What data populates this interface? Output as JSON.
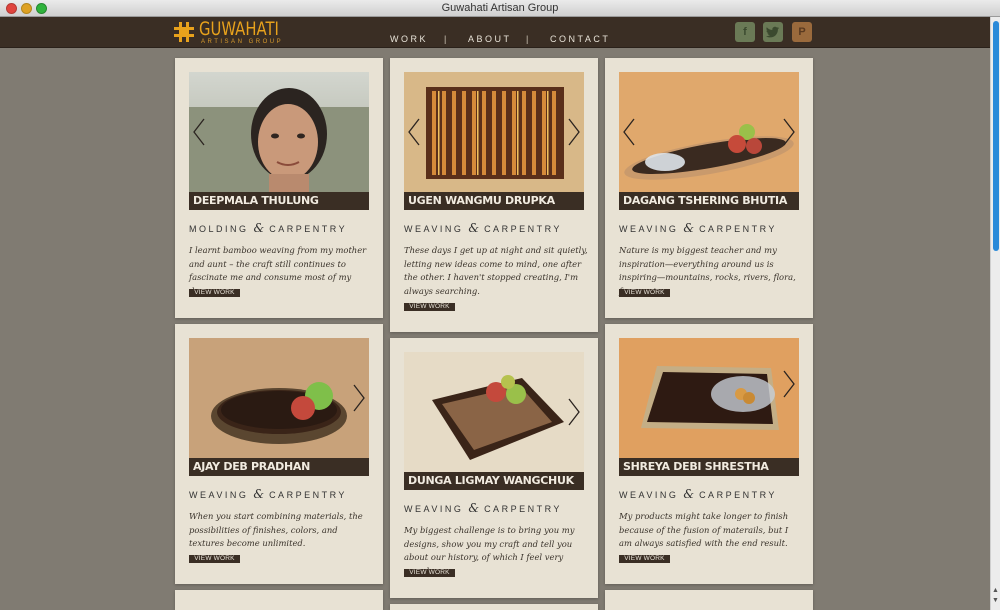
{
  "window": {
    "title": "Guwahati Artisan Group"
  },
  "header": {
    "logo_text": "GUWAHATI",
    "logo_sub": "ARTISAN GROUP",
    "nav": [
      "WORK",
      "|",
      "ABOUT",
      "|",
      "CONTACT"
    ],
    "social": [
      "facebook-icon",
      "twitter-icon",
      "pinterest-icon"
    ]
  },
  "colors": {
    "header_bg": "#3a2e24",
    "accent": "#e8a21c",
    "card_bg": "#e8e2d4",
    "page_bg": "#807b72"
  },
  "cards": [
    {
      "name": "DEEPMALA THULUNG",
      "craft1": "MOLDING",
      "amp": "&",
      "craft2": "CARPENTRY",
      "quote": "I learnt bamboo weaving from my mother and aunt – the craft still continues to fascinate me and consume most of my days.",
      "button": "VIEW WORK"
    },
    {
      "name": "UGEN WANGMU DRUPKA",
      "craft1": "WEAVING",
      "amp": "&",
      "craft2": "CARPENTRY",
      "quote": "These days I get up at night and sit quietly, letting new ideas come to mind, one after the other. I haven't stopped creating, I'm always searching.",
      "button": "VIEW WORK"
    },
    {
      "name": "DAGANG TSHERING BHUTIA",
      "craft1": "WEAVING",
      "amp": "&",
      "craft2": "CARPENTRY",
      "quote": "Nature is my biggest teacher and my inspiration—everything around us is inspiring—mountains, rocks, rivers, flora, fauna, etc.",
      "button": "VIEW WORK"
    },
    {
      "name": "AJAY DEB PRADHAN",
      "craft1": "WEAVING",
      "amp": "&",
      "craft2": "CARPENTRY",
      "quote": "When you start combining materials, the possibilities of finishes, colors, and textures become unlimited.",
      "button": "VIEW WORK"
    },
    {
      "name": "DUNGA LIGMAY WANGCHUK",
      "craft1": "WEAVING",
      "amp": "&",
      "craft2": "CARPENTRY",
      "quote": "My biggest challenge is to bring you my designs, show you my craft and tell you about our history, of which I feel very proud.",
      "button": "VIEW WORK"
    },
    {
      "name": "SHREYA DEBI SHRESTHA",
      "craft1": "WEAVING",
      "amp": "&",
      "craft2": "CARPENTRY",
      "quote": "My products might take longer to finish because of the fusion of materails, but I am always satisfied with the end result.",
      "button": "VIEW WORK"
    }
  ]
}
